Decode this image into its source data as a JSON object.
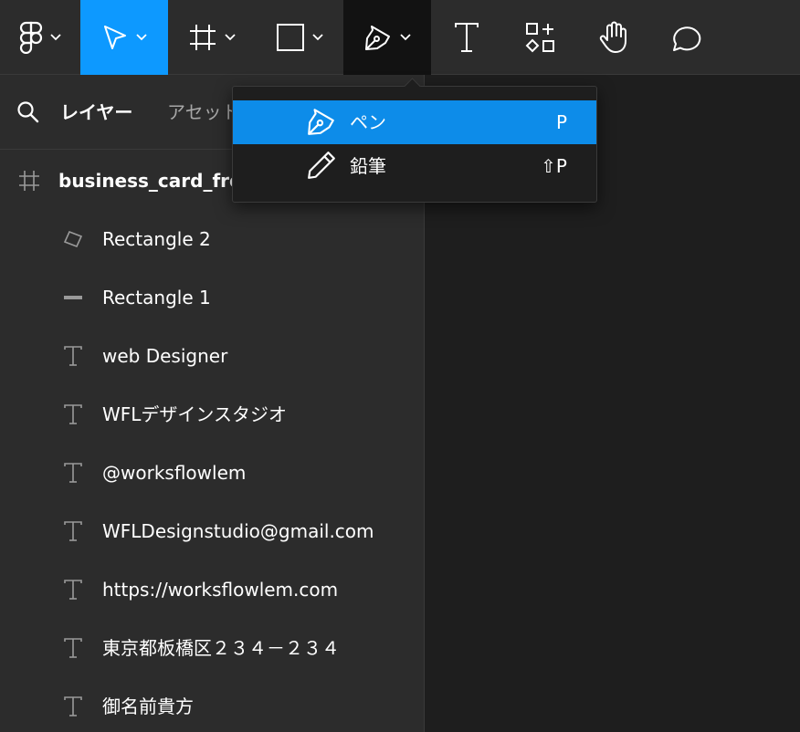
{
  "toolbar": {
    "tools": [
      {
        "id": "main-menu",
        "icon": "figma-logo-icon",
        "has_menu": true
      },
      {
        "id": "move",
        "icon": "move-cursor-icon",
        "has_menu": true,
        "active": true
      },
      {
        "id": "frame",
        "icon": "frame-icon",
        "has_menu": true
      },
      {
        "id": "shape",
        "icon": "rectangle-icon",
        "has_menu": true
      },
      {
        "id": "pen",
        "icon": "pen-icon",
        "has_menu": true,
        "open": true
      },
      {
        "id": "text",
        "icon": "text-icon",
        "has_menu": false
      },
      {
        "id": "resources",
        "icon": "resources-icon",
        "has_menu": false
      },
      {
        "id": "hand",
        "icon": "hand-icon",
        "has_menu": false
      },
      {
        "id": "comment",
        "icon": "comment-icon",
        "has_menu": false
      }
    ],
    "active_color": "#0d99ff"
  },
  "sidebar": {
    "tabs": {
      "layers": "レイヤー",
      "assets": "アセット"
    },
    "frame": {
      "name": "business_card_front",
      "icon": "frame-icon"
    },
    "layers": [
      {
        "name": "Rectangle 2",
        "icon": "rotated-rectangle-icon"
      },
      {
        "name": "Rectangle 1",
        "icon": "line-rectangle-icon"
      },
      {
        "name": "web Designer",
        "icon": "text-layer-icon"
      },
      {
        "name": "WFLデザインスタジオ",
        "icon": "text-layer-icon"
      },
      {
        "name": "@worksflowlem",
        "icon": "text-layer-icon"
      },
      {
        "name": "WFLDesignstudio@gmail.com",
        "icon": "text-layer-icon"
      },
      {
        "name": "https://worksflowlem.com",
        "icon": "text-layer-icon"
      },
      {
        "name": "東京都板橋区２３４－２３４",
        "icon": "text-layer-icon"
      },
      {
        "name": "御名前貴方",
        "icon": "text-layer-icon"
      }
    ]
  },
  "pen_menu": {
    "items": [
      {
        "label": "ペン",
        "shortcut": "P",
        "icon": "pen-icon",
        "selected": true
      },
      {
        "label": "鉛筆",
        "shortcut": "⇧P",
        "icon": "pencil-icon",
        "selected": false
      }
    ]
  }
}
